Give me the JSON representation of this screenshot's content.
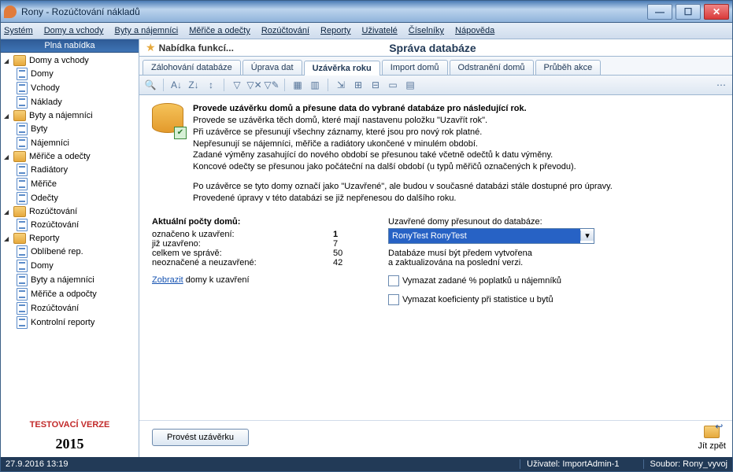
{
  "title": "Rony - Rozúčtování nákladů",
  "menu": [
    "Systém",
    "Domy a vchody",
    "Byty a nájemníci",
    "Měřiče a odečty",
    "Rozúčtování",
    "Reporty",
    "Uživatelé",
    "Číselníky",
    "Nápověda"
  ],
  "sidebar": {
    "header": "Plná nabídka",
    "groups": [
      {
        "label": "Domy a vchody",
        "items": [
          "Domy",
          "Vchody",
          "Náklady"
        ]
      },
      {
        "label": "Byty a nájemníci",
        "items": [
          "Byty",
          "Nájemníci"
        ]
      },
      {
        "label": "Měřiče a odečty",
        "items": [
          "Radiátory",
          "Měřiče",
          "Odečty"
        ]
      },
      {
        "label": "Rozúčtování",
        "items": [
          "Rozúčtování"
        ]
      },
      {
        "label": "Reporty",
        "items": [
          "Oblíbené rep.",
          "Domy",
          "Byty a nájemníci",
          "Měřiče a odpočty",
          "Rozúčtování",
          "Kontrolní reporty"
        ]
      }
    ],
    "test_label": "TESTOVACÍ VERZE",
    "year": "2015"
  },
  "header": {
    "func_label": "Nabídka funkcí...",
    "page_title": "Správa databáze"
  },
  "tabs": [
    "Zálohování databáze",
    "Úprava dat",
    "Uzávěrka roku",
    "Import domů",
    "Odstranění domů",
    "Průběh akce"
  ],
  "active_tab": 2,
  "info": {
    "heading": "Provede uzávěrku domů a přesune data do vybrané databáze pro následující rok.",
    "lines": [
      "Provede se uzávěrka těch domů, které mají nastavenu položku \"Uzavřít rok\".",
      "Při uzávěrce se přesunují všechny záznamy, které jsou pro nový rok platné.",
      "Nepřesunují se nájemníci, měřiče a radiátory ukončené v minulém období.",
      "Zadané výměny zasahující do nového období se přesunou také včetně odečtů k datu výměny.",
      "Koncové odečty se přesunou jako počáteční na další období (u typů měřičů označených k převodu)."
    ],
    "post_lines": [
      "Po uzávěrce se tyto domy označí jako \"Uzavřené\", ale budou v současné databázi stále dostupné pro úpravy.",
      "Provedené úpravy v této databázi se již nepřenesou do dalšího roku."
    ]
  },
  "stats": {
    "title": "Aktuální počty domů:",
    "rows": [
      {
        "label": "označeno k uzavření:",
        "value": "1",
        "bold": true
      },
      {
        "label": "již uzavřeno:",
        "value": "7",
        "bold": false
      },
      {
        "label": "celkem ve správě:",
        "value": "50",
        "bold": false
      },
      {
        "label": "neoznačené a neuzavřené:",
        "value": "42",
        "bold": false
      }
    ],
    "link_text": "Zobrazit",
    "link_rest": " domy k uzavření"
  },
  "right": {
    "move_label": "Uzavřené domy přesunout do databáze:",
    "combo_value": "RonyTest    RonyTest",
    "hint1": "Databáze musí být předem vytvořena",
    "hint2": "a zaktualizována na poslední verzi.",
    "check1": "Vymazat zadané % poplatků u nájemníků",
    "check2": "Vymazat koeficienty při statistice u bytů"
  },
  "actions": {
    "run": "Provést uzávěrku",
    "back": "Jít zpět"
  },
  "status": {
    "datetime": "27.9.2016  13:19",
    "user_label": "Uživatel: ",
    "user": "ImportAdmin-1",
    "file_label": "Soubor: ",
    "file": "Rony_vyvoj"
  }
}
